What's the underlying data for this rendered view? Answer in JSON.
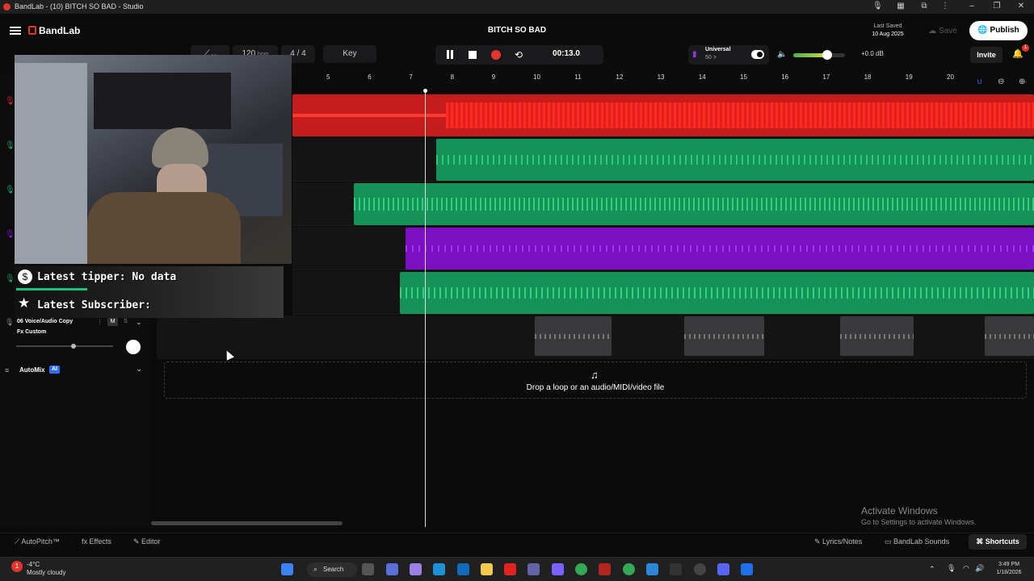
{
  "window": {
    "title": "BandLab - (10) BITCH SO BAD - Studio"
  },
  "header": {
    "logo": "BandLab",
    "song_title": "BITCH SO BAD",
    "last_saved_label": "Last Saved",
    "last_saved_date": "10 Aug 2025",
    "save_label": "Save",
    "publish_label": "Publish",
    "invite_label": "Invite",
    "notifications_count": "1"
  },
  "toolbar": {
    "tempo": "120",
    "tempo_unit": "bpm",
    "time_signature": "4 / 4",
    "key_label": "Key",
    "time": "00:13.0",
    "universal_title": "Universal",
    "universal_sub": "50",
    "master_db": "+0.0 dB",
    "master_level": 0.65
  },
  "ruler": {
    "bars": [
      "5",
      "6",
      "7",
      "8",
      "9",
      "10",
      "11",
      "12",
      "13",
      "14",
      "15",
      "16",
      "17",
      "18",
      "19",
      "20"
    ]
  },
  "tracks": {
    "t6_name": "06 Voice/Audio Copy",
    "t6_fx": "Fx Custom",
    "t6_mute": "M",
    "t6_solo": "S",
    "automix_label": "AutoMix",
    "ai_badge": "AI"
  },
  "overlay": {
    "tipper": "Latest tipper: No data",
    "subscriber": "Latest Subscriber:"
  },
  "drop_zone": {
    "text": "Drop a loop or an audio/MIDI/video file"
  },
  "bottombar": {
    "autopitch": "AutoPitch™",
    "effects": "Effects",
    "editor": "Editor",
    "lyrics": "Lyrics/Notes",
    "sounds": "BandLab Sounds",
    "shortcuts": "Shortcuts"
  },
  "watermark": {
    "line1": "Activate Windows",
    "line2": "Go to Settings to activate Windows."
  },
  "taskbar": {
    "temperature": "-4°C",
    "weather": "Mostly cloudy",
    "search_label": "Search",
    "time": "3:49 PM",
    "date": "1/18/2026"
  },
  "colors": {
    "red_track": "#e3221f",
    "green_track": "#1fa463",
    "purple_track": "#8a12d6",
    "gray_clip": "#3a3a3c"
  }
}
